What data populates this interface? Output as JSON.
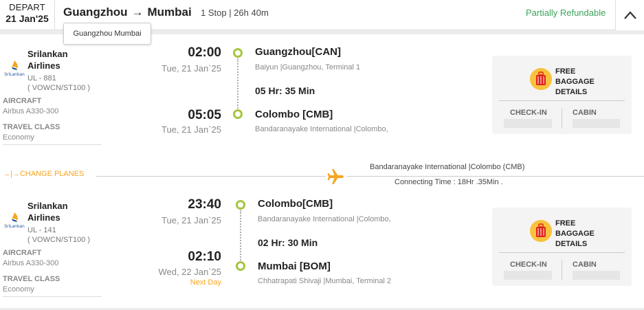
{
  "header": {
    "depart_label": "DEPART",
    "depart_date": "21 Jan'25",
    "origin": "Guangzhou",
    "arrow": "→",
    "destination": "Mumbai",
    "stops_duration": "1 Stop | 26h 40m",
    "refund_status": "Partially Refundable",
    "refund_color": "#3aa35a",
    "tooltip": "Guangzhou Mumbai",
    "collapse_icon": "chevron-up-icon"
  },
  "segments": [
    {
      "airline": "Srilankan Airlines",
      "flight_no": "UL - 881",
      "fare_class": "( VOWCN/ST100 )",
      "aircraft_label": "AIRCRAFT",
      "aircraft": "Airbus A330-300",
      "class_label": "TRAVEL CLASS",
      "travel_class": "Economy",
      "dep_time": "02:00",
      "dep_date": "Tue, 21 Jan`25",
      "dep_city": "Guangzhou[CAN]",
      "dep_airport": "Baiyun |Guangzhou, Terminal 1",
      "duration": "05 Hr: 35 Min",
      "arr_time": "05:05",
      "arr_date": "Tue, 21 Jan`25",
      "arr_city": "Colombo [CMB]",
      "arr_airport": "Bandaranayake International |Colombo,",
      "next_day": ""
    },
    {
      "airline": "Srilankan Airlines",
      "flight_no": "UL - 141",
      "fare_class": "( VOWCN/ST100 )",
      "aircraft_label": "AIRCRAFT",
      "aircraft": "Airbus A330-300",
      "class_label": "TRAVEL CLASS",
      "travel_class": "Economy",
      "dep_time": "23:40",
      "dep_date": "Tue, 21 Jan`25",
      "dep_city": "Colombo[CMB]",
      "dep_airport": "Bandaranayake International |Colombo,",
      "duration": "02 Hr: 30 Min",
      "arr_time": "02:10",
      "arr_date": "Wed, 22 Jan`25",
      "arr_city": "Mumbai [BOM]",
      "arr_airport": "Chhatrapati Shivaji |Mumbai, Terminal 2",
      "next_day": "Next Day"
    }
  ],
  "baggage": {
    "title_line1": "FREE",
    "title_line2": "BAGGAGE",
    "title_line3": "DETAILS",
    "checkin_label": "CHECK-IN",
    "cabin_label": "CABIN",
    "icon": "suitcase-icon"
  },
  "layover": {
    "change_label": "→|→CHANGE PLANES",
    "airport": "Bandaranayake International |Colombo (CMB)",
    "connecting": "Connecting Time : 18Hr .35Min .",
    "icon": "airplane-icon",
    "accent_color": "#f5a623"
  },
  "colors": {
    "timeline_dot": "#a5c53e",
    "airline_logo": "#1b4e9b"
  }
}
